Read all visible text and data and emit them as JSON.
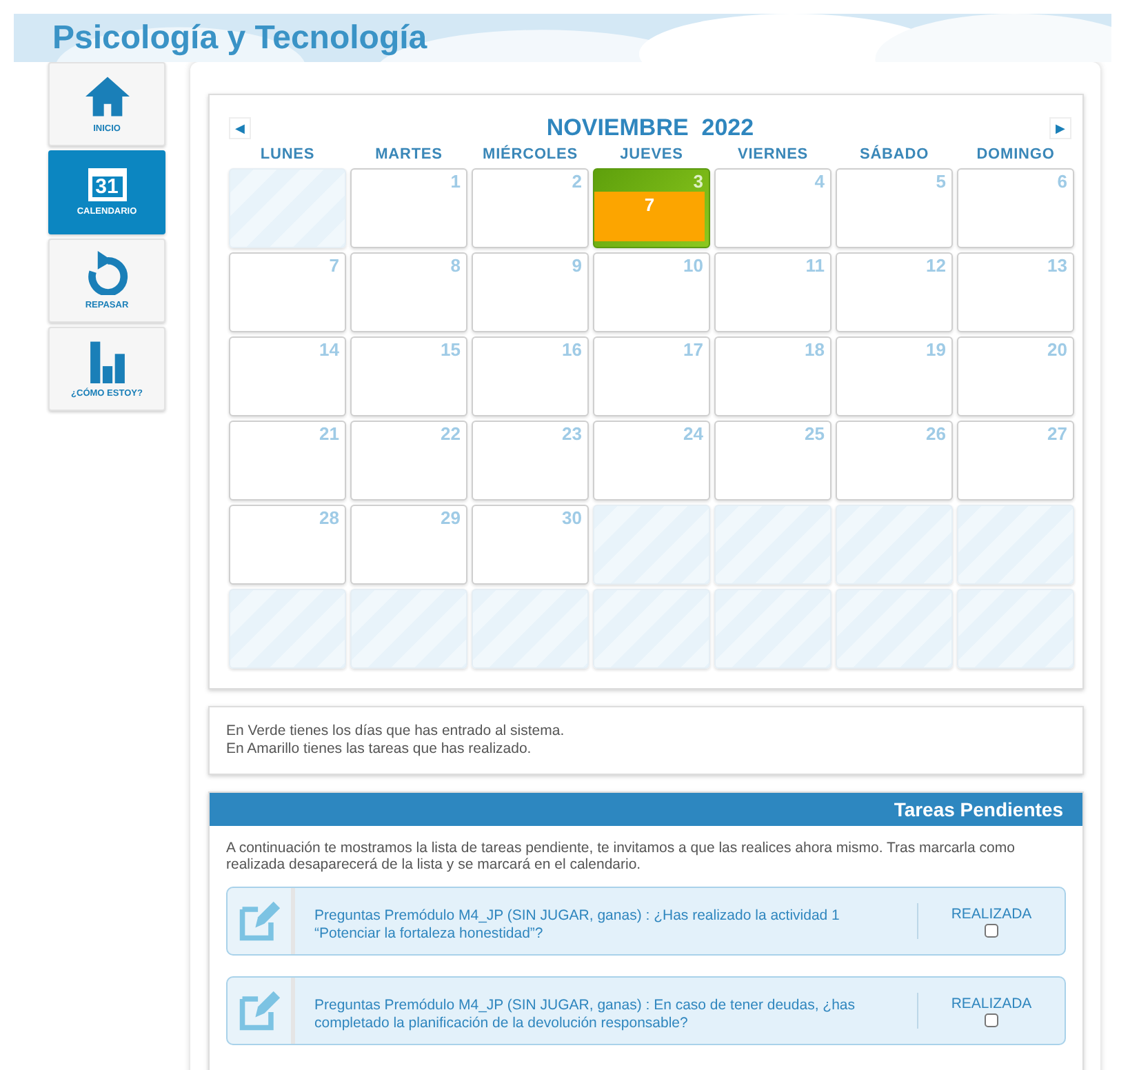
{
  "header": {
    "title": "Psicología y Tecnología"
  },
  "sidebar": {
    "items": [
      {
        "label": "INICIO",
        "kind": "home",
        "selected": false
      },
      {
        "label": "CALENDARIO",
        "kind": "calendar",
        "icon_text": "31",
        "selected": true
      },
      {
        "label": "REPASAR",
        "kind": "repeat",
        "selected": false
      },
      {
        "label": "¿CÓMO ESTOY?",
        "kind": "chart",
        "selected": false
      }
    ]
  },
  "calendar": {
    "prev": "◀",
    "next": "▶",
    "title": "NOVIEMBRE  2022",
    "weekdays": [
      "LUNES",
      "MARTES",
      "MIÉRCOLES",
      "JUEVES",
      "VIERNES",
      "SÁBADO",
      "DOMINGO"
    ],
    "weeks": [
      [
        {
          "kind": "blank"
        },
        {
          "kind": "day",
          "day": "1",
          "visited": false
        },
        {
          "kind": "day",
          "day": "2",
          "visited": false
        },
        {
          "kind": "day",
          "day": "3",
          "visited": true,
          "tasks": "7"
        },
        {
          "kind": "day",
          "day": "4",
          "visited": false
        },
        {
          "kind": "day",
          "day": "5",
          "visited": false
        },
        {
          "kind": "day",
          "day": "6",
          "visited": false
        }
      ],
      [
        {
          "kind": "day",
          "day": "7",
          "visited": false
        },
        {
          "kind": "day",
          "day": "8",
          "visited": false
        },
        {
          "kind": "day",
          "day": "9",
          "visited": false
        },
        {
          "kind": "day",
          "day": "10",
          "visited": false
        },
        {
          "kind": "day",
          "day": "11",
          "visited": false
        },
        {
          "kind": "day",
          "day": "12",
          "visited": false
        },
        {
          "kind": "day",
          "day": "13",
          "visited": false
        }
      ],
      [
        {
          "kind": "day",
          "day": "14",
          "visited": false
        },
        {
          "kind": "day",
          "day": "15",
          "visited": false
        },
        {
          "kind": "day",
          "day": "16",
          "visited": false
        },
        {
          "kind": "day",
          "day": "17",
          "visited": false
        },
        {
          "kind": "day",
          "day": "18",
          "visited": false
        },
        {
          "kind": "day",
          "day": "19",
          "visited": false
        },
        {
          "kind": "day",
          "day": "20",
          "visited": false
        }
      ],
      [
        {
          "kind": "day",
          "day": "21",
          "visited": false
        },
        {
          "kind": "day",
          "day": "22",
          "visited": false
        },
        {
          "kind": "day",
          "day": "23",
          "visited": false
        },
        {
          "kind": "day",
          "day": "24",
          "visited": false
        },
        {
          "kind": "day",
          "day": "25",
          "visited": false
        },
        {
          "kind": "day",
          "day": "26",
          "visited": false
        },
        {
          "kind": "day",
          "day": "27",
          "visited": false
        }
      ],
      [
        {
          "kind": "day",
          "day": "28",
          "visited": false
        },
        {
          "kind": "day",
          "day": "29",
          "visited": false
        },
        {
          "kind": "day",
          "day": "30",
          "visited": false
        },
        {
          "kind": "blank"
        },
        {
          "kind": "blank"
        },
        {
          "kind": "blank"
        },
        {
          "kind": "blank"
        }
      ],
      [
        {
          "kind": "blank"
        },
        {
          "kind": "blank"
        },
        {
          "kind": "blank"
        },
        {
          "kind": "blank"
        },
        {
          "kind": "blank"
        },
        {
          "kind": "blank"
        },
        {
          "kind": "blank"
        }
      ]
    ]
  },
  "legend": [
    "En Verde tienes los días que has entrado al sistema.",
    "En Amarillo tienes las tareas que has realizado."
  ],
  "tasks": {
    "title": "Tareas Pendientes",
    "intro": "A continuación te mostramos la lista de tareas pendiente, te invitamos a que las realices ahora mismo. Tras marcarla como realizada desaparecerá de la lista y se marcará en el calendario.",
    "items": [
      {
        "text": "Preguntas Premódulo M4_JP (SIN JUGAR, ganas) : ¿Has realizado la actividad 1 “Potenciar la fortaleza honestidad”?",
        "done_label": "REALIZADA",
        "checked": false
      },
      {
        "text": "Preguntas Premódulo M4_JP (SIN JUGAR, ganas) : En caso de tener deudas, ¿has completado la planificación de la devolución responsable?",
        "done_label": "REALIZADA",
        "checked": false
      }
    ]
  }
}
